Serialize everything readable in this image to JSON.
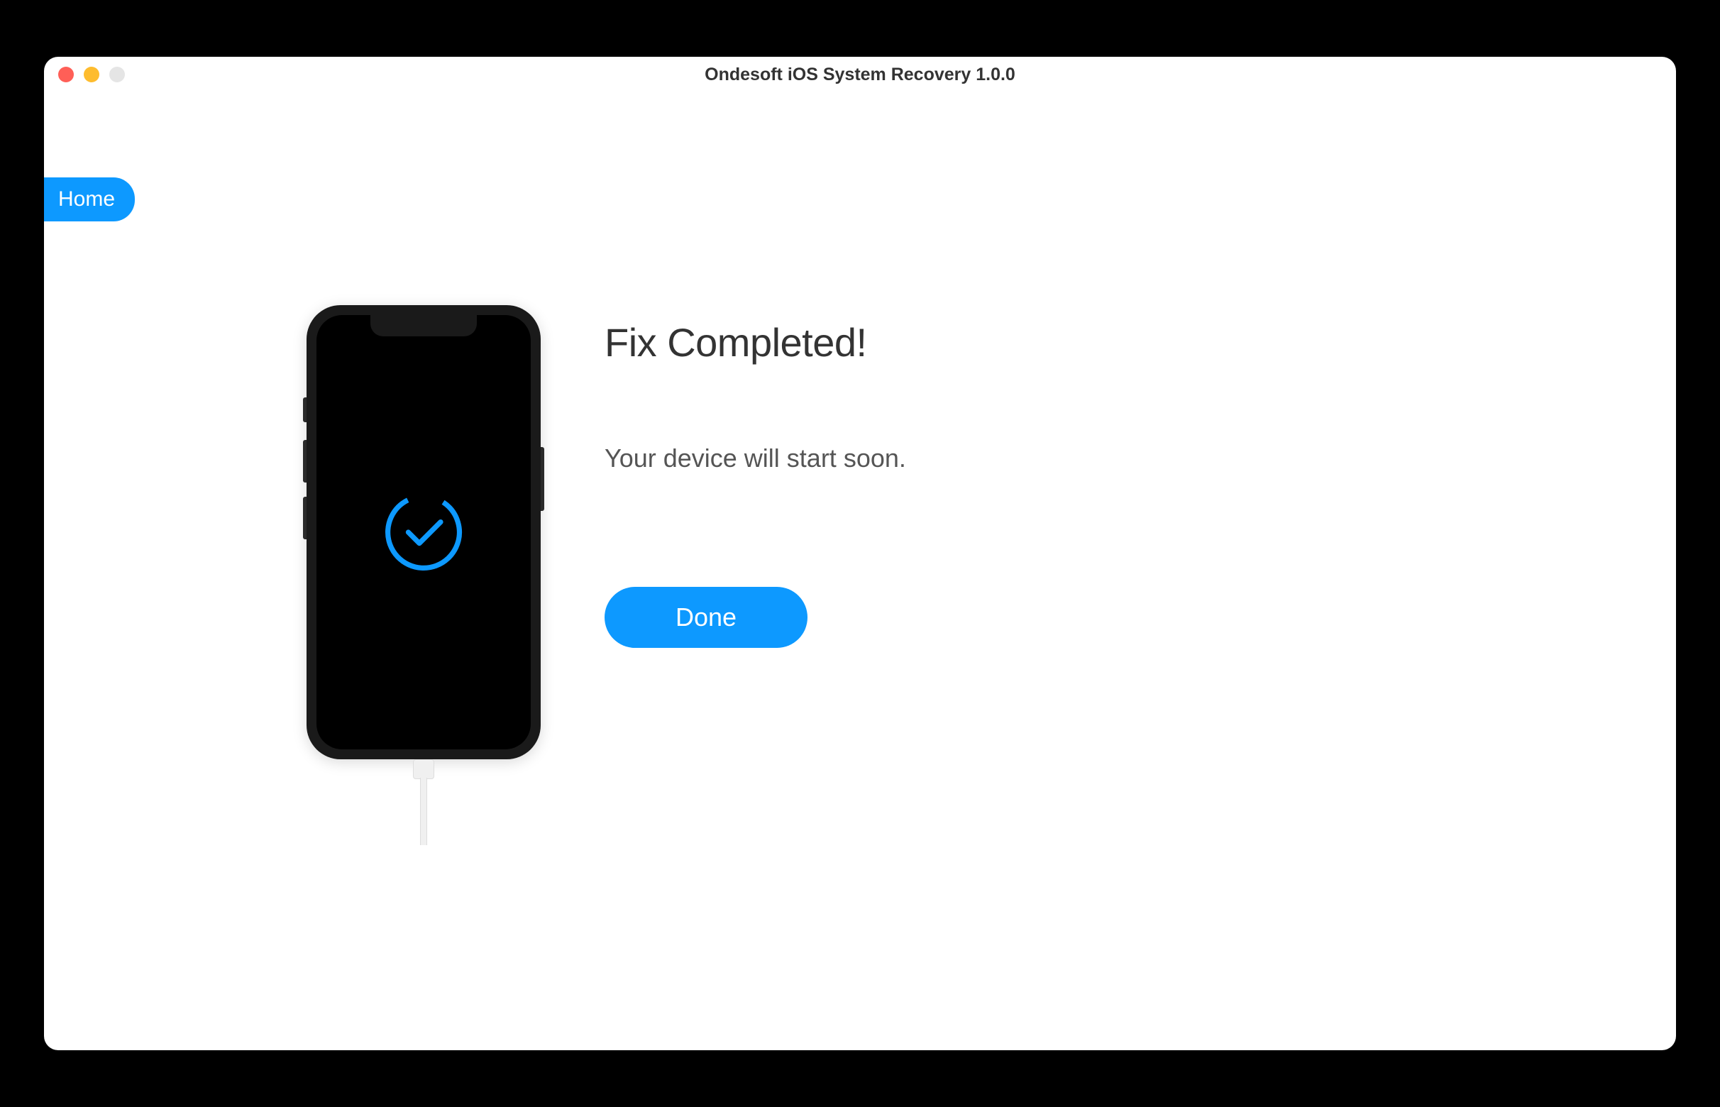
{
  "window": {
    "title": "Ondesoft iOS System Recovery 1.0.0"
  },
  "nav": {
    "home_label": "Home"
  },
  "main": {
    "heading": "Fix Completed!",
    "subtext": "Your device will start soon.",
    "done_label": "Done"
  },
  "device": {
    "status_icon": "checkmark-circle"
  },
  "colors": {
    "accent": "#0d99ff"
  }
}
